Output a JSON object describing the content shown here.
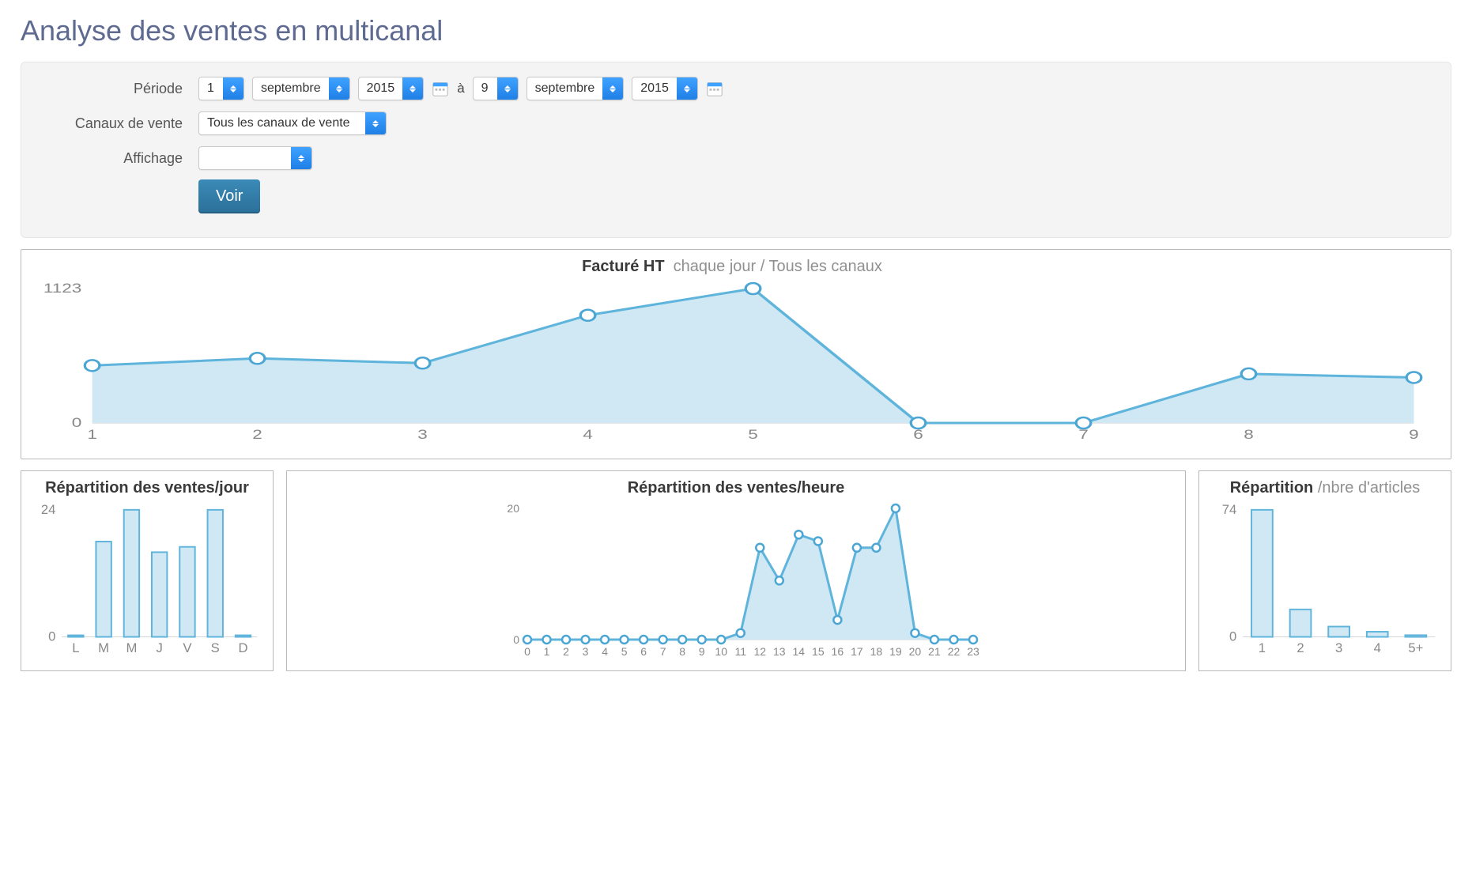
{
  "page": {
    "title": "Analyse des ventes en multicanal"
  },
  "filters": {
    "period_label": "Période",
    "channel_label": "Canaux de vente",
    "display_label": "Affichage",
    "channel_value": "Tous les canaux de vente",
    "display_value": "",
    "from": {
      "day": "1",
      "month": "septembre",
      "year": "2015"
    },
    "sep": "à",
    "to": {
      "day": "9",
      "month": "septembre",
      "year": "2015"
    },
    "button": "Voir"
  },
  "main_chart": {
    "title_bold": "Facturé HT",
    "title_muted": "chaque jour / Tous les canaux"
  },
  "small_charts": {
    "per_day": {
      "title_bold": "Répartition des ventes/jour"
    },
    "per_hour": {
      "title_bold": "Répartition des ventes/heure"
    },
    "per_articles": {
      "title_bold": "Répartition ",
      "title_muted": "/nbre d'articles"
    }
  },
  "chart_data": [
    {
      "id": "main",
      "type": "area",
      "title": "Facturé HT  chaque jour / Tous les canaux",
      "xlabel": "",
      "ylabel": "",
      "x": [
        1,
        2,
        3,
        4,
        5,
        6,
        7,
        8,
        9
      ],
      "values": [
        480,
        540,
        500,
        900,
        1123,
        0,
        0,
        410,
        380
      ],
      "ylim": [
        0,
        1123
      ],
      "y_ticks": [
        0,
        1123
      ]
    },
    {
      "id": "per_day",
      "type": "bar",
      "title": "Répartition des ventes/jour",
      "categories": [
        "L",
        "M",
        "M",
        "J",
        "V",
        "S",
        "D"
      ],
      "values": [
        0.3,
        18,
        24,
        16,
        17,
        24,
        0.3
      ],
      "ylim": [
        0,
        24
      ],
      "y_ticks": [
        0,
        24
      ]
    },
    {
      "id": "per_hour",
      "type": "area",
      "title": "Répartition des ventes/heure",
      "x": [
        0,
        1,
        2,
        3,
        4,
        5,
        6,
        7,
        8,
        9,
        10,
        11,
        12,
        13,
        14,
        15,
        16,
        17,
        18,
        19,
        20,
        21,
        22,
        23
      ],
      "values": [
        0,
        0,
        0,
        0,
        0,
        0,
        0,
        0,
        0,
        0,
        0,
        1,
        14,
        9,
        16,
        15,
        3,
        14,
        14,
        20,
        1,
        0,
        0,
        0
      ],
      "ylim": [
        0,
        20
      ],
      "y_ticks": [
        0,
        20
      ]
    },
    {
      "id": "per_articles",
      "type": "bar",
      "title": "Répartition /nbre d'articles",
      "categories": [
        "1",
        "2",
        "3",
        "4",
        "5+"
      ],
      "values": [
        74,
        16,
        6,
        3,
        1
      ],
      "ylim": [
        0,
        74
      ],
      "y_ticks": [
        0,
        74
      ]
    }
  ]
}
